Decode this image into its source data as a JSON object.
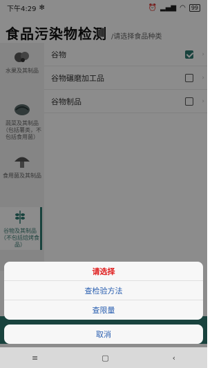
{
  "status": {
    "time": "下午4:29",
    "battery": "99"
  },
  "header": {
    "title": "食品污染物检测",
    "subtitle": "/请选择食品种类"
  },
  "sidebar": {
    "items": [
      {
        "label": "水果及其制品"
      },
      {
        "label": "蔬菜及其制品（包括薯类，不包括食用菌）"
      },
      {
        "label": "食用菌及其制品"
      },
      {
        "label": "谷物及其制品（不包括焙烤食品）"
      }
    ]
  },
  "list": {
    "rows": [
      {
        "label": "谷物",
        "checked": true
      },
      {
        "label": "谷物碾磨加工品",
        "checked": false
      },
      {
        "label": "谷物制品",
        "checked": false
      }
    ]
  },
  "sheet": {
    "header": "请选择",
    "options": [
      "查检验方法",
      "查限量"
    ],
    "cancel": "取消"
  },
  "colors": {
    "accent": "#2e7b71",
    "danger": "#e02020",
    "link": "#2a5fb0"
  }
}
